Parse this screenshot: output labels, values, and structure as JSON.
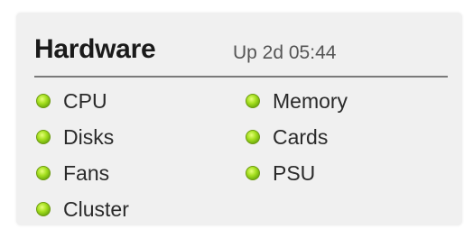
{
  "panel": {
    "title": "Hardware",
    "uptime": "Up 2d 05:44"
  },
  "status_color": "#8bcf1a",
  "components": {
    "left": [
      {
        "label": "CPU",
        "status": "ok"
      },
      {
        "label": "Disks",
        "status": "ok"
      },
      {
        "label": "Fans",
        "status": "ok"
      },
      {
        "label": "Cluster",
        "status": "ok"
      }
    ],
    "right": [
      {
        "label": "Memory",
        "status": "ok"
      },
      {
        "label": "Cards",
        "status": "ok"
      },
      {
        "label": "PSU",
        "status": "ok"
      }
    ]
  }
}
